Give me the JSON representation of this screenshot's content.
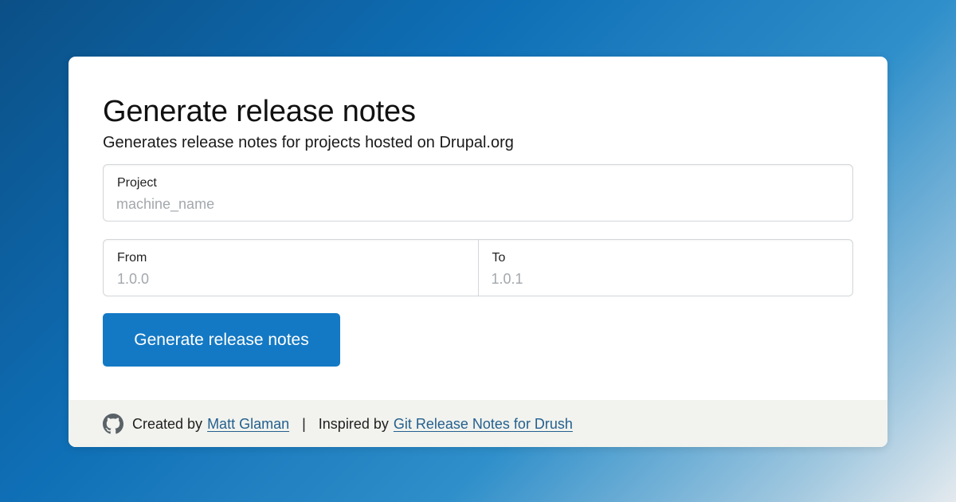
{
  "card": {
    "title": "Generate release notes",
    "subtitle": "Generates release notes for projects hosted on Drupal.org"
  },
  "form": {
    "project": {
      "label": "Project",
      "placeholder": "machine_name",
      "value": ""
    },
    "from": {
      "label": "From",
      "placeholder": "1.0.0",
      "value": ""
    },
    "to": {
      "label": "To",
      "placeholder": "1.0.1",
      "value": ""
    },
    "submit_label": "Generate release notes"
  },
  "footer": {
    "icon": "github-icon",
    "created_prefix": "Created by",
    "author_link": "Matt Glaman",
    "separator": "|",
    "inspired_prefix": "Inspired by",
    "inspired_link": "Git Release Notes for Drush"
  },
  "colors": {
    "primary_button": "#1479c4",
    "link": "#24608f",
    "footer_background": "#f2f3ee",
    "background_gradient_start": "#0b4f86",
    "background_gradient_end": "#e4eaee"
  }
}
